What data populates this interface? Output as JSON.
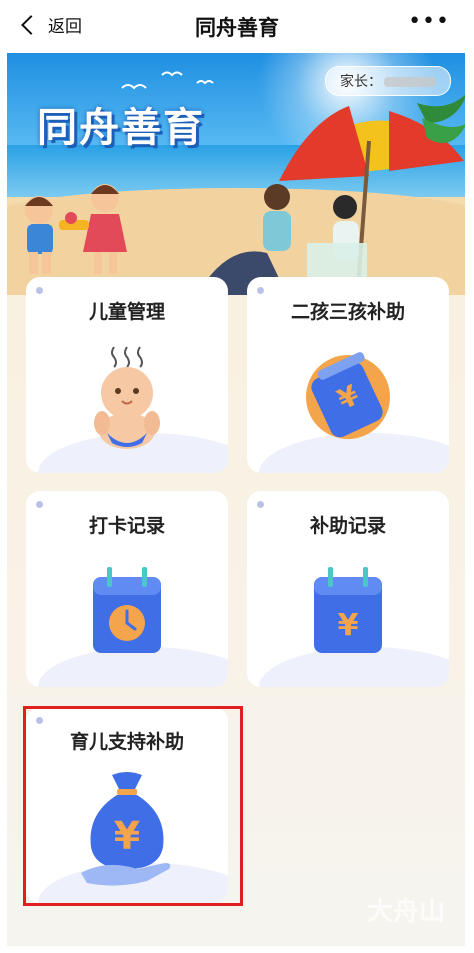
{
  "header": {
    "back_label": "返回",
    "title": "同舟善育",
    "more_label": "•••"
  },
  "banner": {
    "brand_text": "同舟善育",
    "parent_label": "家长："
  },
  "cards": [
    {
      "label": "儿童管理",
      "icon": "baby-icon"
    },
    {
      "label": "二孩三孩补助",
      "icon": "yuan-card-icon"
    },
    {
      "label": "打卡记录",
      "icon": "calendar-clock-icon"
    },
    {
      "label": "补助记录",
      "icon": "calendar-yuan-icon"
    },
    {
      "label": "育儿支持补助",
      "icon": "money-bag-icon"
    }
  ],
  "watermark": "大舟山",
  "colors": {
    "primary_blue": "#3f6ee6",
    "highlight_red": "#e02020",
    "orange": "#f4a44a"
  }
}
